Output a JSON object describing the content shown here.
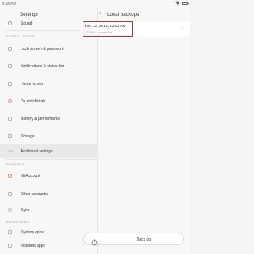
{
  "status": {
    "time": "2:56 PM"
  },
  "settings": {
    "title": "Settings",
    "top_item": "Sound",
    "system_section": "SYSTEM & DEVICE",
    "system_items": [
      "Lock screen & password",
      "Notifications & status bar",
      "Home screen",
      "Do not disturb",
      "Battery & performance",
      "Storage",
      "Additional settings"
    ],
    "accounts_section": "ACCOUNTS",
    "account_items": [
      "Mi Account",
      "Other accounts",
      "Sync"
    ],
    "apps_section": "APP SETTINGS",
    "app_items": [
      "System apps",
      "Installed apps"
    ]
  },
  "detail": {
    "back_glyph": "‹",
    "title": "Local backups",
    "entry_date": "Dec 12, 2016, 12:00 AM",
    "entry_sub": "1.27MB, 4 app data files",
    "chevron": "›",
    "backup_button": "Back up"
  },
  "icons": {
    "item_icon_color": "#9bbfb0",
    "highlight_color": "#cc2b2b"
  }
}
